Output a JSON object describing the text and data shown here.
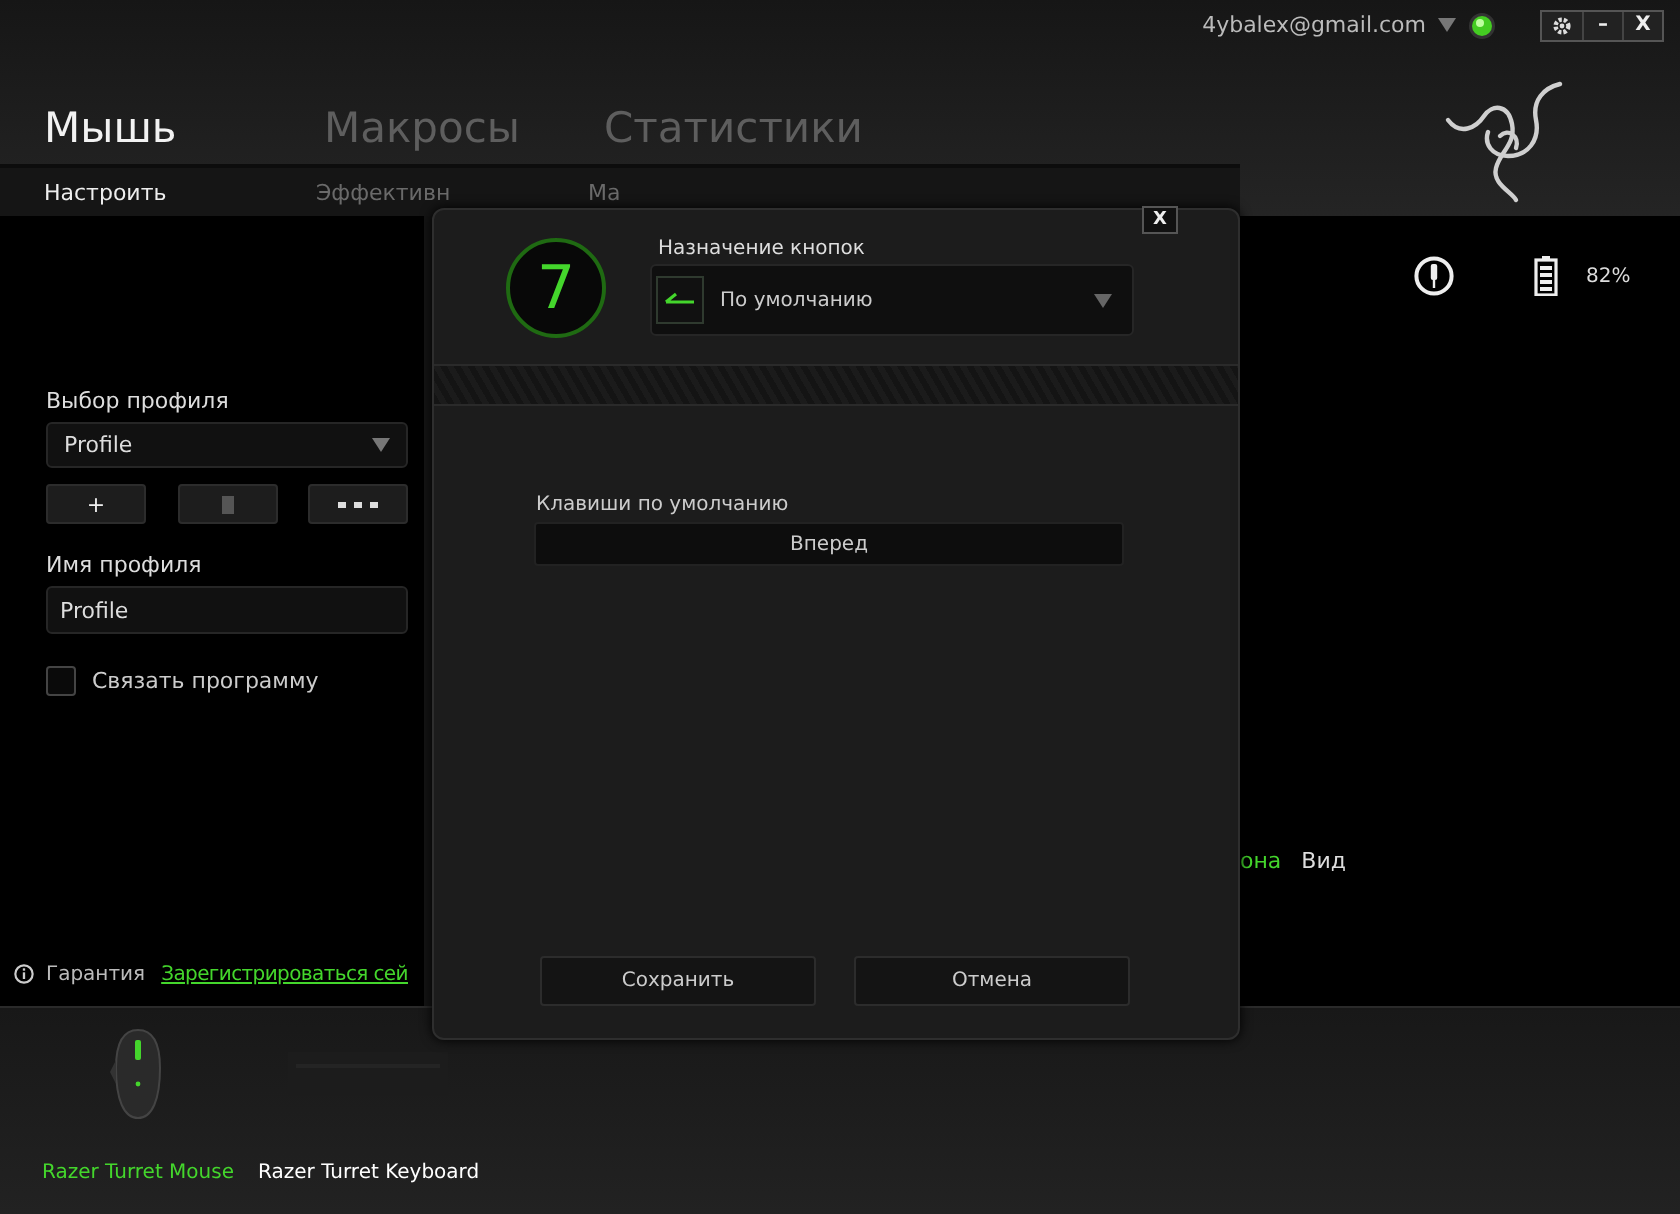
{
  "top_bar": {
    "account": "4ybalex@gmail.com",
    "window_buttons": [
      "–",
      "X"
    ]
  },
  "main_tabs": [
    {
      "label": "Мышь",
      "selected": true
    },
    {
      "label": "Макросы",
      "selected": false
    },
    {
      "label": "Статистики",
      "selected": false
    }
  ],
  "sub_tabs": [
    {
      "label": "Настроить",
      "selected": true
    },
    {
      "label": "Эффективн",
      "selected": false
    },
    {
      "label": "Ма",
      "selected": false
    }
  ],
  "profile": {
    "select_label": "Выбор профиля",
    "select_value": "Profile",
    "add_button": "+",
    "name_label": "Имя профиля",
    "name_value": "Profile",
    "link_program": {
      "label": "Связать программу",
      "checked": false
    }
  },
  "warranty": {
    "label": "Гарантия",
    "link": "Зарегистрироваться сей"
  },
  "status": {
    "battery": "82%"
  },
  "view_links": [
    {
      "label": "она",
      "selected": true
    },
    {
      "label": "Вид",
      "selected": false
    }
  ],
  "devices": [
    {
      "name": "Razer Turret Mouse",
      "kind": "mouse",
      "selected": true
    },
    {
      "name": "Razer Turret Keyboard",
      "kind": "keyboard",
      "selected": false
    }
  ],
  "dialog": {
    "close": "X",
    "button_number": "7",
    "assign_label": "Назначение кнопок",
    "assign_value": "По умолчанию",
    "keys_label": "Клавиши по умолчанию",
    "keys_value": "Вперед",
    "buttons": [
      "Сохранить",
      "Отмена"
    ]
  }
}
